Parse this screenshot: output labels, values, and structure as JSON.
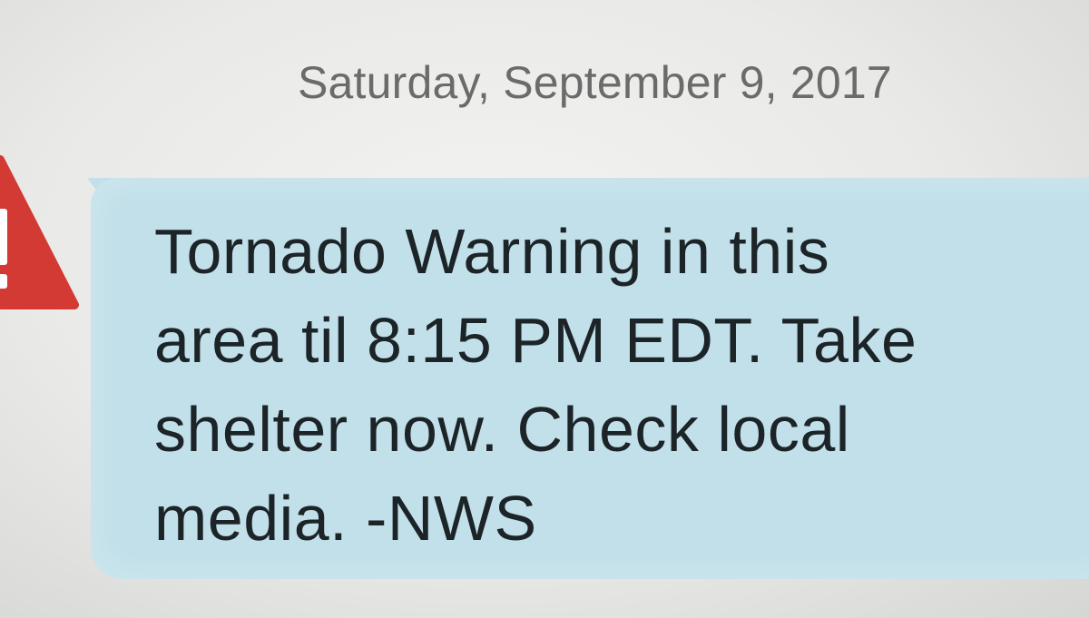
{
  "conversation": {
    "date_header": "Saturday, September 9, 2017"
  },
  "alert_message": {
    "icon": "warning-triangle-icon",
    "icon_color": "#d23a33",
    "bubble_color": "#c2e0ea",
    "lines": [
      "Tornado Warning in this",
      "area til 8:15 PM EDT. Take",
      "shelter now. Check local",
      "media. -NWS"
    ]
  }
}
